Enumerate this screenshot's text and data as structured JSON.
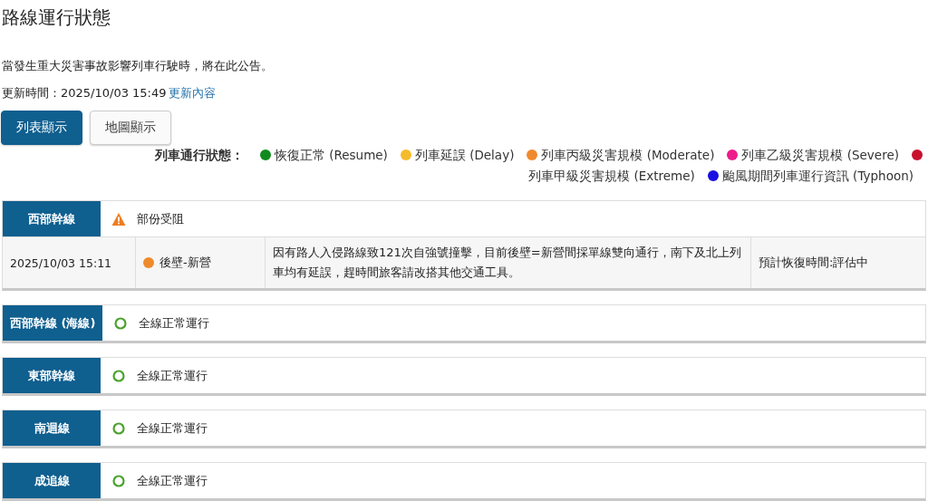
{
  "title": "路線運行狀態",
  "notice": "當發生重大災害事故影響列車行駛時，將在此公告。",
  "update": {
    "label": "更新時間：2025/10/03 15:49",
    "link": "更新內容"
  },
  "view_tabs": [
    {
      "label": "列表顯示",
      "selected": true
    },
    {
      "label": "地圖顯示",
      "selected": false
    }
  ],
  "legend": {
    "title": "列車通行狀態：",
    "items": [
      {
        "label": "恢復正常 (Resume)",
        "color": "#118a1e"
      },
      {
        "label": "列車延誤 (Delay)",
        "color": "#f5bb2a"
      },
      {
        "label": "列車丙級災害規模 (Moderate)",
        "color": "#ef8a2c"
      },
      {
        "label": "列車乙級災害規模 (Severe)",
        "color": "#ec1c8c"
      },
      {
        "label": "列車甲級災害規模 (Extreme)",
        "color": "#c8102e"
      },
      {
        "label": "颱風期間列車運行資訊 (Typhoon)",
        "color": "#1a0fe0"
      }
    ]
  },
  "lines": [
    {
      "name": "西部幹線",
      "kind": "warning",
      "status": "部份受阻",
      "incidents": [
        {
          "time": "2025/10/03 15:11",
          "color": "#ef8a2c",
          "section": "後壁-新營",
          "description": "因有路人入侵路線致121次自強號撞擊，目前後壁=新營間採單線雙向通行，南下及北上列車均有延誤，趕時間旅客請改搭其他交通工具。",
          "recovery": "預計恢復時間:評估中"
        }
      ]
    },
    {
      "name": "西部幹線 (海線)",
      "kind": "normal",
      "status": "全線正常運行"
    },
    {
      "name": "東部幹線",
      "kind": "normal",
      "status": "全線正常運行"
    },
    {
      "name": "南迴線",
      "kind": "normal",
      "status": "全線正常運行"
    },
    {
      "name": "成追線",
      "kind": "normal",
      "status": "全線正常運行"
    }
  ]
}
